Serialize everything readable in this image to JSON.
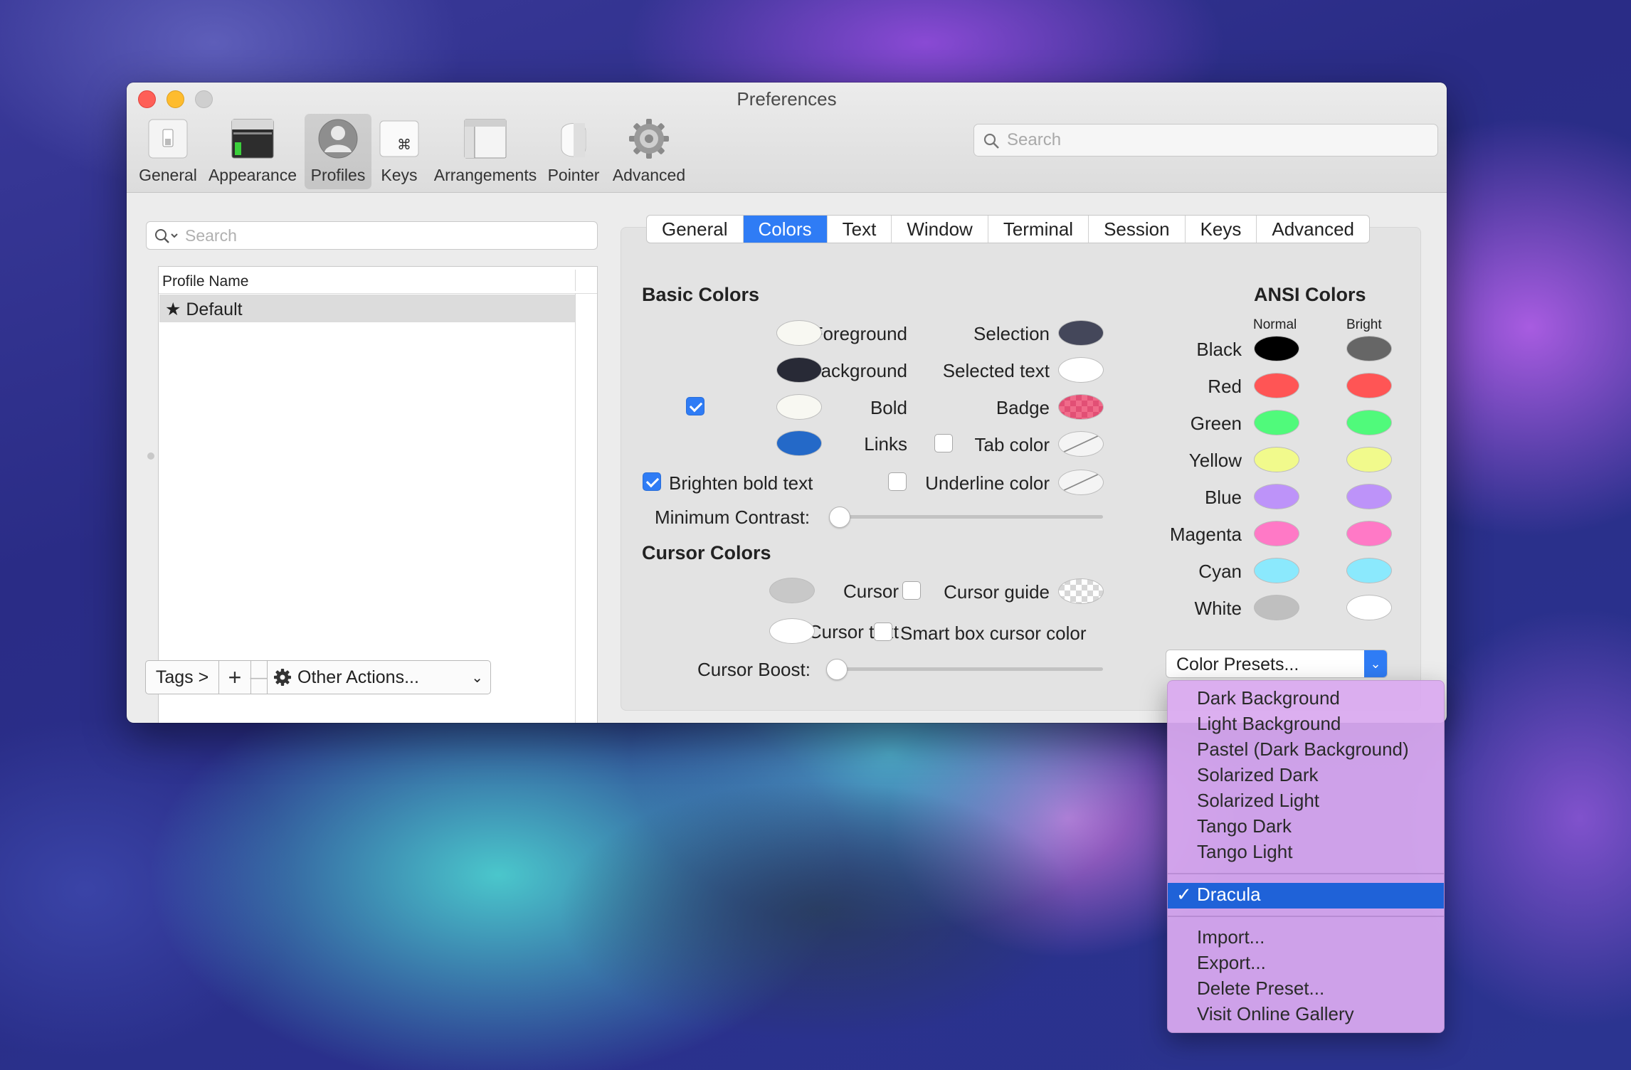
{
  "window": {
    "title": "Preferences"
  },
  "toolbar": {
    "items": [
      {
        "label": "General",
        "icon": "general-switch-icon"
      },
      {
        "label": "Appearance",
        "icon": "appearance-window-icon"
      },
      {
        "label": "Profiles",
        "icon": "profiles-person-icon"
      },
      {
        "label": "Keys",
        "icon": "keys-command-icon"
      },
      {
        "label": "Arrangements",
        "icon": "arrangements-window-icon"
      },
      {
        "label": "Pointer",
        "icon": "pointer-mouse-icon"
      },
      {
        "label": "Advanced",
        "icon": "advanced-gear-icon"
      }
    ],
    "selected": "Profiles",
    "search_placeholder": "Search"
  },
  "profiles": {
    "search_placeholder": "Search",
    "column_header": "Profile Name",
    "items": [
      {
        "name": "Default",
        "starred": true
      }
    ],
    "buttons": {
      "tags": "Tags >",
      "add": "+",
      "remove": "—",
      "other_actions": "Other Actions..."
    }
  },
  "tabs": {
    "items": [
      "General",
      "Colors",
      "Text",
      "Window",
      "Terminal",
      "Session",
      "Keys",
      "Advanced"
    ],
    "active": "Colors"
  },
  "basic_colors": {
    "heading": "Basic Colors",
    "foreground": {
      "label": "Foreground",
      "color": "#f8f8f2"
    },
    "background": {
      "label": "Background",
      "color": "#282a36"
    },
    "bold": {
      "label": "Bold",
      "checked": true,
      "color": "#f8f8f2"
    },
    "links": {
      "label": "Links",
      "color": "#2469c8"
    },
    "selection": {
      "label": "Selection",
      "color": "#44475a"
    },
    "selected_text": {
      "label": "Selected text",
      "color": "#ffffff"
    },
    "badge": {
      "label": "Badge",
      "color": "#f06b8a"
    },
    "tab_color": {
      "label": "Tab color",
      "checked": false
    },
    "underline_color": {
      "label": "Underline color",
      "checked": false
    },
    "brighten_bold": {
      "label": "Brighten bold text",
      "checked": true
    },
    "min_contrast": {
      "label": "Minimum Contrast:",
      "value": 0
    }
  },
  "cursor_colors": {
    "heading": "Cursor Colors",
    "cursor": {
      "label": "Cursor",
      "color": "#c8c8c8"
    },
    "cursor_text": {
      "label": "Cursor text",
      "color": "#ffffff"
    },
    "cursor_guide": {
      "label": "Cursor guide",
      "checked": false
    },
    "smart_box": {
      "label": "Smart box cursor color",
      "checked": false
    },
    "cursor_boost": {
      "label": "Cursor Boost:",
      "value": 0
    }
  },
  "ansi": {
    "heading": "ANSI Colors",
    "col_normal": "Normal",
    "col_bright": "Bright",
    "rows": [
      {
        "name": "Black",
        "normal": "#000000",
        "bright": "#666666"
      },
      {
        "name": "Red",
        "normal": "#ff5555",
        "bright": "#ff5555"
      },
      {
        "name": "Green",
        "normal": "#50fa7b",
        "bright": "#50fa7b"
      },
      {
        "name": "Yellow",
        "normal": "#f1fa8c",
        "bright": "#f1fa8c"
      },
      {
        "name": "Blue",
        "normal": "#bd93f9",
        "bright": "#bd93f9"
      },
      {
        "name": "Magenta",
        "normal": "#ff79c6",
        "bright": "#ff79c6"
      },
      {
        "name": "Cyan",
        "normal": "#8be9fd",
        "bright": "#8be9fd"
      },
      {
        "name": "White",
        "normal": "#bfbfbf",
        "bright": "#ffffff"
      }
    ]
  },
  "presets": {
    "label": "Color Presets...",
    "menu_group1": [
      "Dark Background",
      "Light Background",
      "Pastel (Dark Background)",
      "Solarized Dark",
      "Solarized Light",
      "Tango Dark",
      "Tango Light"
    ],
    "selected": "Dracula",
    "check": "✓",
    "menu_group3": [
      "Import...",
      "Export...",
      "Delete Preset...",
      "Visit Online Gallery"
    ]
  },
  "accent": "#2f7cf5"
}
